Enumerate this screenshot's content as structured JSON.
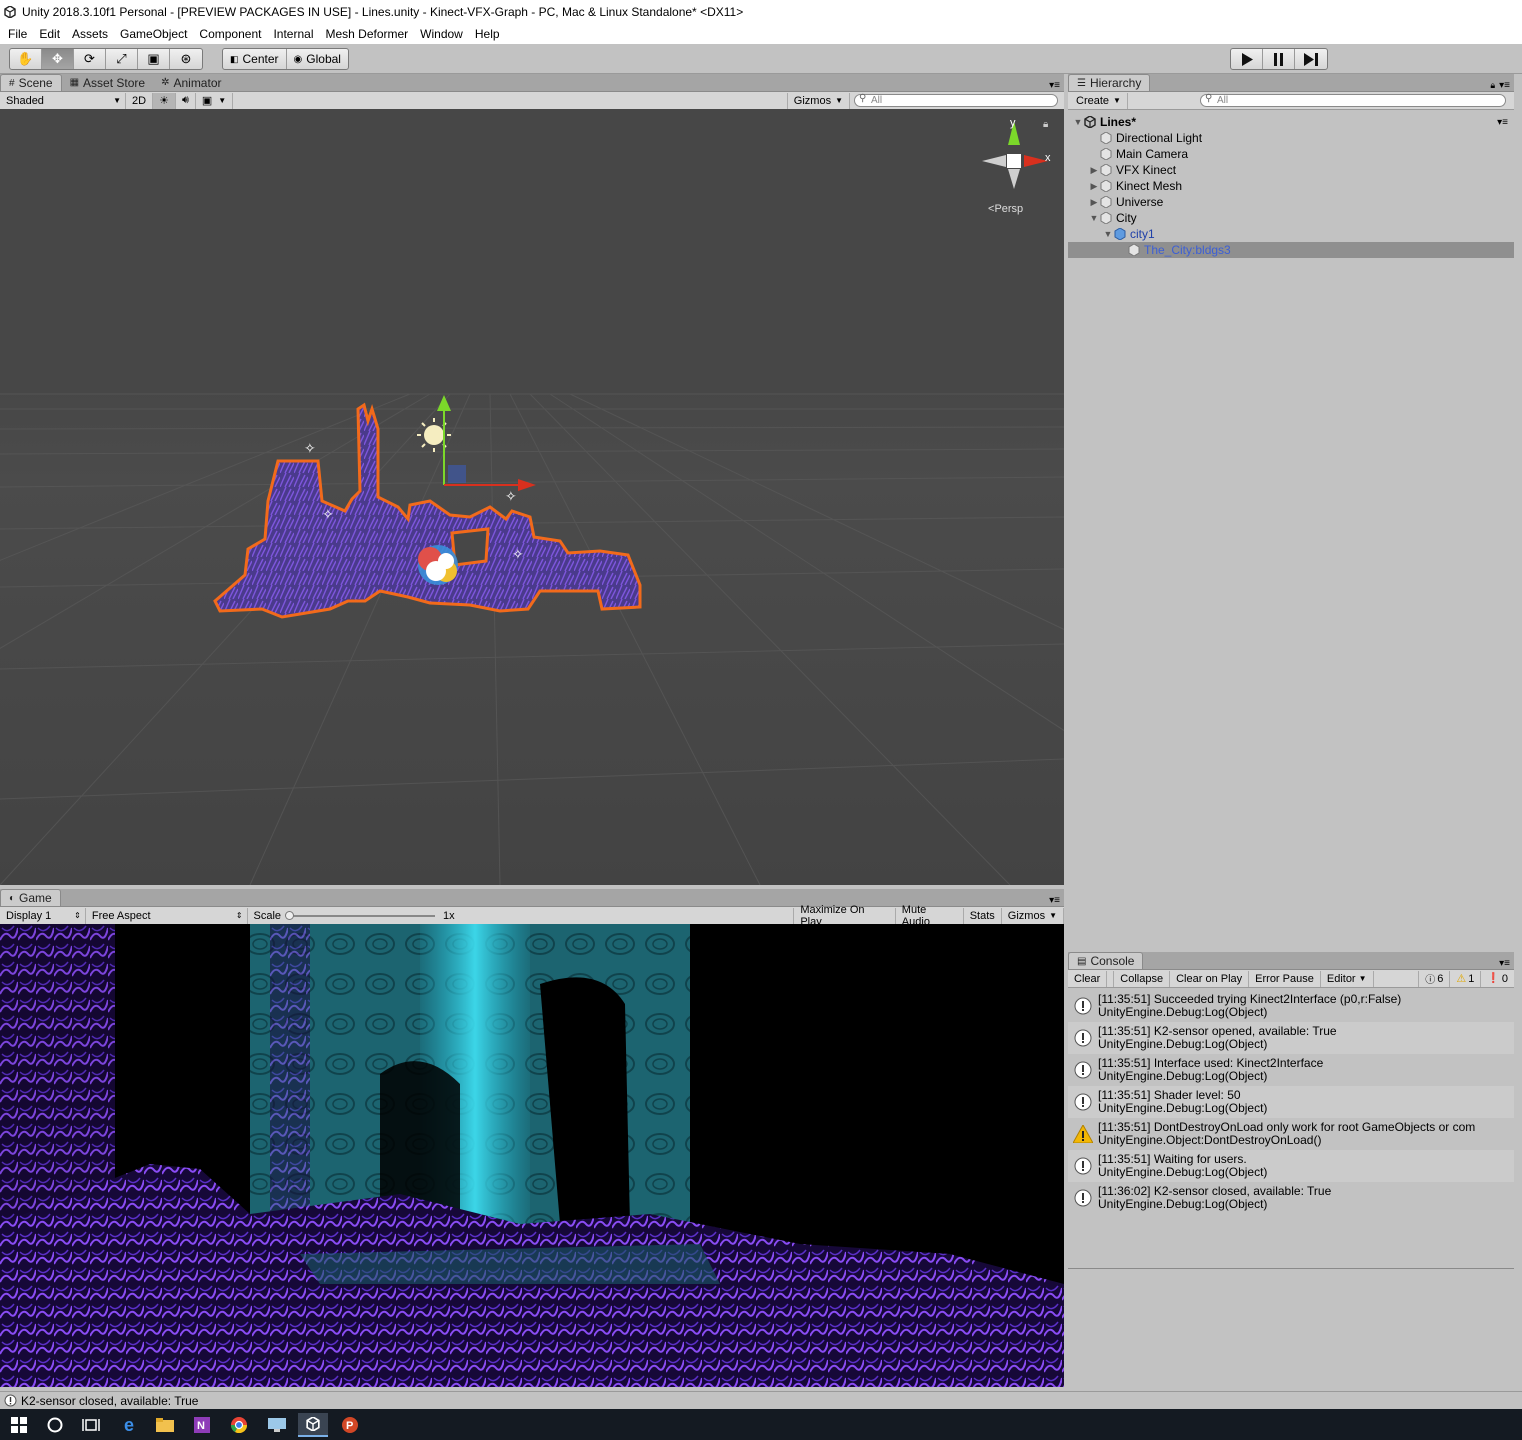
{
  "window": {
    "title": "Unity 2018.3.10f1 Personal - [PREVIEW PACKAGES IN USE] - Lines.unity - Kinect-VFX-Graph - PC, Mac & Linux Standalone* <DX11>"
  },
  "menu": [
    "File",
    "Edit",
    "Assets",
    "GameObject",
    "Component",
    "Internal",
    "Mesh Deformer",
    "Window",
    "Help"
  ],
  "toolbar": {
    "pivot": "Center",
    "space": "Global"
  },
  "scene_tabs": {
    "scene": "Scene",
    "asset_store": "Asset Store",
    "animator": "Animator"
  },
  "scene_bar": {
    "shading": "Shaded",
    "mode_2d": "2D",
    "gizmos": "Gizmos",
    "search_placeholder": "All"
  },
  "scene_gizmo": {
    "y": "y",
    "x": "x",
    "persp": "Persp"
  },
  "game": {
    "tab": "Game",
    "display": "Display 1",
    "aspect": "Free Aspect",
    "scale_label": "Scale",
    "scale_value": "1x",
    "maximize": "Maximize On Play",
    "mute": "Mute Audio",
    "stats": "Stats",
    "gizmos": "Gizmos"
  },
  "hierarchy": {
    "tab": "Hierarchy",
    "create": "Create",
    "search_placeholder": "All",
    "scene_name": "Lines*",
    "items": [
      {
        "label": "Directional Light"
      },
      {
        "label": "Main Camera"
      },
      {
        "label": "VFX Kinect"
      },
      {
        "label": "Kinect Mesh"
      },
      {
        "label": "Universe"
      },
      {
        "label": "City"
      },
      {
        "label": "city1"
      },
      {
        "label": "The_City:bldgs3"
      }
    ]
  },
  "console": {
    "tab": "Console",
    "buttons": {
      "clear": "Clear",
      "collapse": "Collapse",
      "clear_on_play": "Clear on Play",
      "error_pause": "Error Pause",
      "editor": "Editor"
    },
    "counts": {
      "info": "6",
      "warn": "1",
      "error": "0"
    },
    "entries": [
      {
        "line1": "[11:35:51] Succeeded trying Kinect2Interface (p0,r:False)",
        "line2": "UnityEngine.Debug:Log(Object)",
        "level": "info"
      },
      {
        "line1": "[11:35:51] K2-sensor opened, available: True",
        "line2": "UnityEngine.Debug:Log(Object)",
        "level": "info"
      },
      {
        "line1": "[11:35:51] Interface used: Kinect2Interface",
        "line2": "UnityEngine.Debug:Log(Object)",
        "level": "info"
      },
      {
        "line1": "[11:35:51] Shader level: 50",
        "line2": "UnityEngine.Debug:Log(Object)",
        "level": "info"
      },
      {
        "line1": "[11:35:51] DontDestroyOnLoad only work for root GameObjects or com",
        "line2": "UnityEngine.Object:DontDestroyOnLoad()",
        "level": "warn"
      },
      {
        "line1": "[11:35:51] Waiting for users.",
        "line2": "UnityEngine.Debug:Log(Object)",
        "level": "info"
      },
      {
        "line1": "[11:36:02] K2-sensor closed, available: True",
        "line2": "UnityEngine.Debug:Log(Object)",
        "level": "info"
      }
    ]
  },
  "status": {
    "message": "K2-sensor closed, available: True"
  },
  "colors": {
    "selection_outline": "#f26a1b",
    "city_fill": "#5b3fa8",
    "hierarchy_selected": "#8f8f8f",
    "selected_text": "#3c5fd6"
  }
}
